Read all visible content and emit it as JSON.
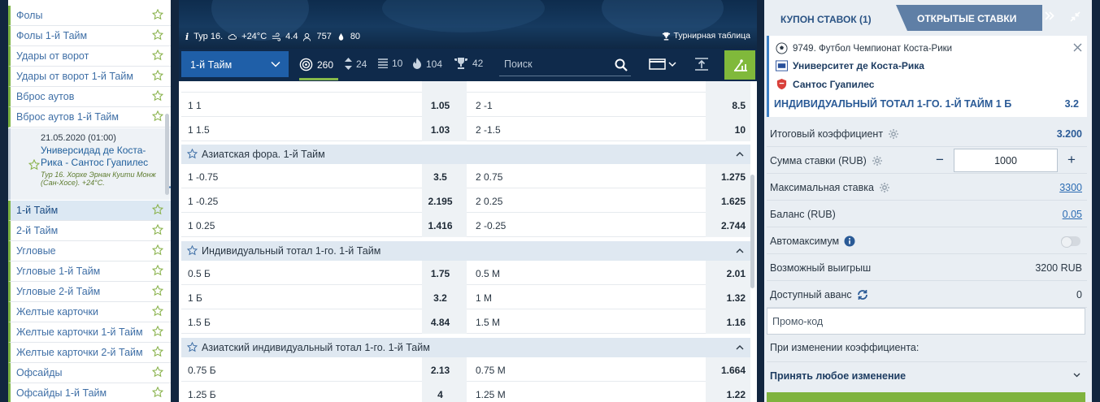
{
  "sidebar": {
    "items": [
      {
        "label": "Фолы",
        "active": false
      },
      {
        "label": "Фолы 1-й Тайм",
        "active": false
      },
      {
        "label": "Удары от ворот",
        "active": false
      },
      {
        "label": "Удары от ворот 1-й Тайм",
        "active": false
      },
      {
        "label": "Вброс аутов",
        "active": false
      },
      {
        "label": "Вброс аутов 1-й Тайм",
        "active": false
      },
      {
        "label": "1-й Тайм",
        "active": true
      },
      {
        "label": "2-й Тайм",
        "active": false
      },
      {
        "label": "Угловые",
        "active": false
      },
      {
        "label": "Угловые 1-й Тайм",
        "active": false
      },
      {
        "label": "Угловые 2-й Тайм",
        "active": false
      },
      {
        "label": "Желтые карточки",
        "active": false
      },
      {
        "label": "Желтые карточки 1-й Тайм",
        "active": false
      },
      {
        "label": "Желтые карточки 2-й Тайм",
        "active": false
      },
      {
        "label": "Офсайды",
        "active": false
      },
      {
        "label": "Офсайды 1-й Тайм",
        "active": false
      }
    ],
    "match": {
      "date": "21.05.2020 (01:00)",
      "teams": "Универсидад де Коста-Рика - Сантос Гуапилес",
      "info": "Тур 16. Хорхе Эрнан Куити Монж (Сан-Хосе). +24°C."
    }
  },
  "banner": {
    "round": "Тур 16.",
    "temperature": "+24°C",
    "wind": "4.4",
    "attendance": "757",
    "humidity": "80",
    "table_link": "Турнирная таблица"
  },
  "toolbar": {
    "period": "1-й Тайм",
    "counts": [
      {
        "icon": "target-icon",
        "value": "260"
      },
      {
        "icon": "updown-icon",
        "value": "24"
      },
      {
        "icon": "stats-icon",
        "value": "10"
      },
      {
        "icon": "fire-icon",
        "value": "104"
      },
      {
        "icon": "trophy-icon",
        "value": "42"
      }
    ],
    "search_placeholder": "Поиск"
  },
  "markets": {
    "top_rows": [
      {
        "o1": "1 1",
        "k1": "1.05",
        "o2": "2 -1",
        "k2": "8.5"
      },
      {
        "o1": "1 1.5",
        "k1": "1.03",
        "o2": "2 -1.5",
        "k2": "10"
      }
    ],
    "groups": [
      {
        "title": "Азиатская фора. 1-й Тайм",
        "rows": [
          {
            "o1": "1 -0.75",
            "k1": "3.5",
            "o2": "2 0.75",
            "k2": "1.275"
          },
          {
            "o1": "1 -0.25",
            "k1": "2.195",
            "o2": "2 0.25",
            "k2": "1.625"
          },
          {
            "o1": "1 0.25",
            "k1": "1.416",
            "o2": "2 -0.25",
            "k2": "2.744"
          }
        ]
      },
      {
        "title": "Индивидуальный тотал 1-го. 1-й Тайм",
        "rows": [
          {
            "o1": "0.5 Б",
            "k1": "1.75",
            "o2": "0.5 М",
            "k2": "2.01"
          },
          {
            "o1": "1 Б",
            "k1": "3.2",
            "o2": "1 М",
            "k2": "1.32"
          },
          {
            "o1": "1.5 Б",
            "k1": "4.84",
            "o2": "1.5 М",
            "k2": "1.16"
          }
        ]
      },
      {
        "title": "Азиатский индивидуальный тотал 1-го. 1-й Тайм",
        "rows": [
          {
            "o1": "0.75 Б",
            "k1": "2.13",
            "o2": "0.75 М",
            "k2": "1.664"
          },
          {
            "o1": "1.25 Б",
            "k1": "4",
            "o2": "1.25 М",
            "k2": "1.22"
          }
        ]
      }
    ]
  },
  "coupon": {
    "tab_coupon": "КУПОН СТАВОК (1)",
    "tab_open": "ОТКРЫТЫЕ СТАВКИ",
    "bet": {
      "event": "9749. Футбол Чемпионат Коста-Рики",
      "team1": "Университет де Коста-Рика",
      "team2": "Сантос Гуапилес",
      "description": "ИНДИВИДУАЛЬНЫЙ ТОТАЛ 1-ГО. 1-Й ТАЙМ  1 Б",
      "odd": "3.2"
    },
    "total_odds_label": "Итоговый коэффициент",
    "total_odds": "3.200",
    "stake_label": "Сумма ставки (RUB)",
    "stake_value": "1000",
    "max_bet_label": "Максимальная ставка",
    "max_bet": "3300",
    "balance_label": "Баланс (RUB)",
    "balance": "0.05",
    "automax_label": "Автомаксимум",
    "possible_win_label": "Возможный выигрыш",
    "possible_win": "3200 RUB",
    "advance_label": "Доступный аванс",
    "advance": "0",
    "promo_placeholder": "Промо-код",
    "change_label": "При изменении коэффициента:",
    "change_value": "Принять любое изменение"
  },
  "colors": {
    "accent_green": "#80b93b",
    "navy": "#12263f",
    "link_blue": "#3f6fa6"
  }
}
